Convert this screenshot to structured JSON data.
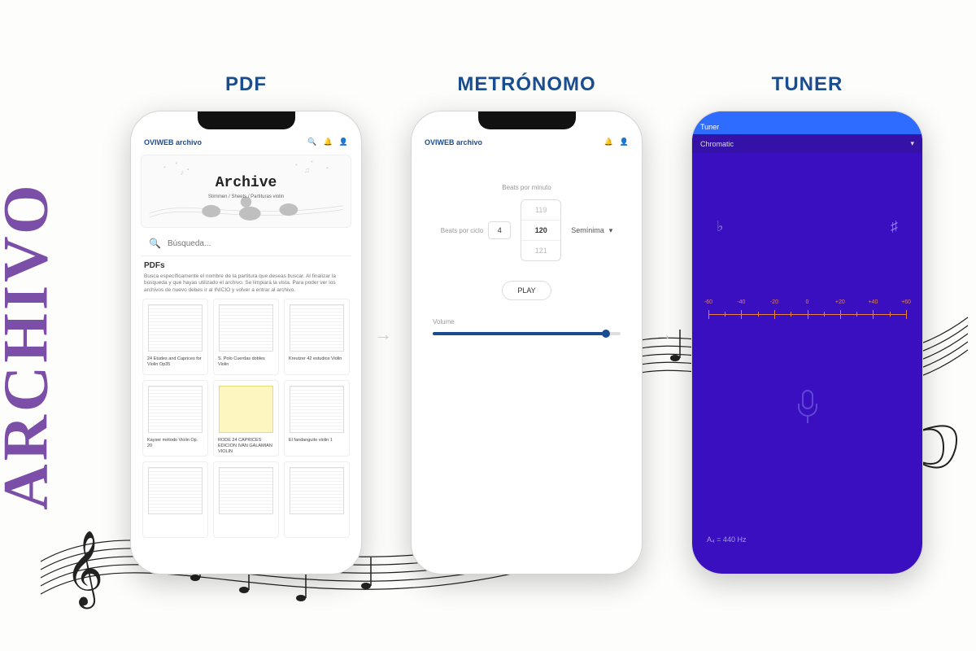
{
  "sidebar_label": "ARCHIVO",
  "columns": {
    "pdf": "PDF",
    "metronome": "METRÓNOMO",
    "tuner": "TUNER"
  },
  "pdf": {
    "appbar_title": "OVIWEB archivo",
    "hero_title": "Archive",
    "hero_sub": "Stimmen / Sheets /\nPartituras violin",
    "search_placeholder": "Búsqueda...",
    "section": "PDFs",
    "helper": "Busca específicamente el nombre de la partitura que deseas buscar. Al finalizar la búsqueda y que hayas utilizado el archivo. Se limpiará la vista. Para poder ver los archivos de nuevo debes ir al INICIO y volver a entrar al archivo.",
    "items": [
      {
        "title": "24 Etudes and Caprices for Violin Op35"
      },
      {
        "title": "S. Polo Cuerdas dobles Violin"
      },
      {
        "title": "Kreutzer 42 estudios Violin"
      },
      {
        "title": "Kayser método Violin Op. 20"
      },
      {
        "title": "RODE 24 CAPRICES EDICION IVAN GALAMIAN VIOLIN"
      },
      {
        "title": "El fandanguito violin 1"
      }
    ]
  },
  "metronome": {
    "appbar_title": "OVIWEB archivo",
    "bpm_label": "Beats por minuto",
    "bpc_label": "Beats por ciclo",
    "bpc_value": "4",
    "bpm_prev": "119",
    "bpm_current": "120",
    "bpm_next": "121",
    "note_value": "Semínima",
    "play_label": "PLAY",
    "volume_label": "Volume",
    "volume_percent": 92
  },
  "tuner": {
    "title": "Tuner",
    "mode": "Chromatic",
    "flat_symbol": "♭",
    "sharp_symbol": "♯",
    "ticks": [
      "-60",
      "-40",
      "-20",
      "0",
      "+20",
      "+40",
      "+60"
    ],
    "reference": "A₄ = 440 Hz"
  }
}
